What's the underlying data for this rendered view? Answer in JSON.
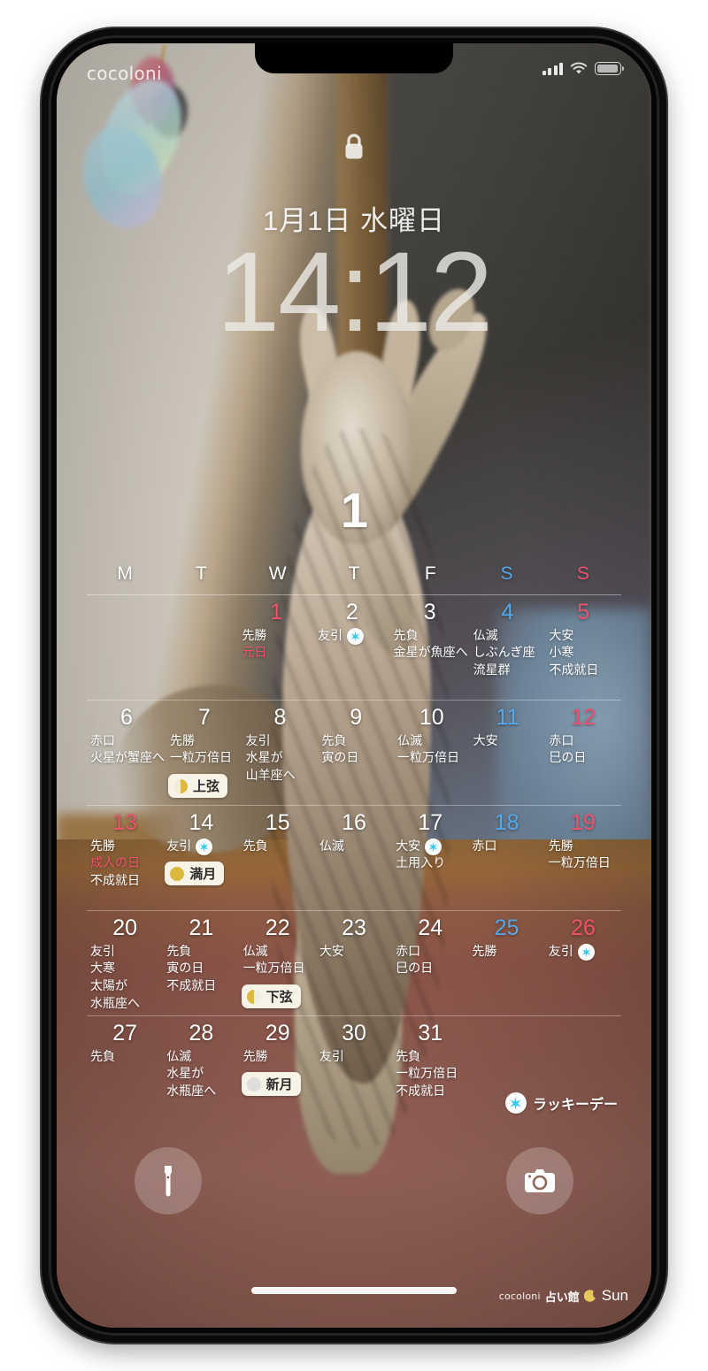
{
  "device": {
    "brand_watermark": "cocoloni"
  },
  "status_bar": {
    "signal_icon": "cellular-bars-icon",
    "wifi_icon": "wifi-icon",
    "battery_icon": "battery-icon"
  },
  "lock_screen": {
    "lock_icon": "lock-icon",
    "date": "1月1日 水曜日",
    "time": "14:12"
  },
  "calendar": {
    "month_label": "1",
    "weekday_headers": [
      {
        "label": "M",
        "kind": "weekday"
      },
      {
        "label": "T",
        "kind": "weekday"
      },
      {
        "label": "W",
        "kind": "weekday"
      },
      {
        "label": "T",
        "kind": "weekday"
      },
      {
        "label": "F",
        "kind": "weekday"
      },
      {
        "label": "S",
        "kind": "saturday"
      },
      {
        "label": "S",
        "kind": "sunday"
      }
    ],
    "weeks": [
      [
        {
          "day": ""
        },
        {
          "day": ""
        },
        {
          "day": "1",
          "kind": "holiday",
          "rokuyo": "先勝",
          "notes": [
            {
              "text": "元日",
              "holiday": true
            }
          ]
        },
        {
          "day": "2",
          "rokuyo": "友引",
          "lucky": true
        },
        {
          "day": "3",
          "rokuyo": "先負",
          "notes": [
            {
              "text": "金星が魚座へ"
            }
          ]
        },
        {
          "day": "4",
          "kind": "saturday",
          "rokuyo": "仏滅",
          "notes": [
            {
              "text": "しぶんぎ座"
            },
            {
              "text": "流星群"
            }
          ]
        },
        {
          "day": "5",
          "kind": "sunday",
          "rokuyo": "大安",
          "notes": [
            {
              "text": "小寒"
            },
            {
              "text": "不成就日"
            }
          ]
        }
      ],
      [
        {
          "day": "6",
          "rokuyo": "赤口",
          "notes": [
            {
              "text": "火星が蟹座へ"
            }
          ]
        },
        {
          "day": "7",
          "rokuyo": "先勝",
          "notes": [
            {
              "text": "一粒万倍日"
            }
          ],
          "moon": {
            "label": "上弦",
            "phase": "first-quarter"
          }
        },
        {
          "day": "8",
          "rokuyo": "友引",
          "notes": [
            {
              "text": "水星が"
            },
            {
              "text": "山羊座へ"
            }
          ]
        },
        {
          "day": "9",
          "rokuyo": "先負",
          "notes": [
            {
              "text": "寅の日"
            }
          ]
        },
        {
          "day": "10",
          "rokuyo": "仏滅",
          "notes": [
            {
              "text": "一粒万倍日"
            }
          ]
        },
        {
          "day": "11",
          "kind": "saturday",
          "rokuyo": "大安"
        },
        {
          "day": "12",
          "kind": "sunday",
          "rokuyo": "赤口",
          "notes": [
            {
              "text": "巳の日"
            }
          ]
        }
      ],
      [
        {
          "day": "13",
          "kind": "holiday",
          "rokuyo": "先勝",
          "notes": [
            {
              "text": "成人の日",
              "holiday": true
            },
            {
              "text": "不成就日"
            }
          ]
        },
        {
          "day": "14",
          "rokuyo": "友引",
          "lucky": true,
          "moon": {
            "label": "満月",
            "phase": "full"
          }
        },
        {
          "day": "15",
          "rokuyo": "先負"
        },
        {
          "day": "16",
          "rokuyo": "仏滅"
        },
        {
          "day": "17",
          "rokuyo": "大安",
          "lucky": true,
          "notes": [
            {
              "text": "土用入り"
            }
          ]
        },
        {
          "day": "18",
          "kind": "saturday",
          "rokuyo": "赤口"
        },
        {
          "day": "19",
          "kind": "sunday",
          "rokuyo": "先勝",
          "notes": [
            {
              "text": "一粒万倍日"
            }
          ]
        }
      ],
      [
        {
          "day": "20",
          "rokuyo": "友引",
          "notes": [
            {
              "text": "大寒"
            },
            {
              "text": "太陽が"
            },
            {
              "text": "水瓶座へ"
            }
          ]
        },
        {
          "day": "21",
          "rokuyo": "先負",
          "notes": [
            {
              "text": "寅の日"
            },
            {
              "text": "不成就日"
            }
          ]
        },
        {
          "day": "22",
          "rokuyo": "仏滅",
          "notes": [
            {
              "text": "一粒万倍日"
            }
          ],
          "moon": {
            "label": "下弦",
            "phase": "last-quarter"
          }
        },
        {
          "day": "23",
          "rokuyo": "大安"
        },
        {
          "day": "24",
          "rokuyo": "赤口",
          "notes": [
            {
              "text": "巳の日"
            }
          ]
        },
        {
          "day": "25",
          "kind": "saturday",
          "rokuyo": "先勝"
        },
        {
          "day": "26",
          "kind": "sunday",
          "rokuyo": "友引",
          "lucky": true
        }
      ],
      [
        {
          "day": "27",
          "rokuyo": "先負"
        },
        {
          "day": "28",
          "rokuyo": "仏滅",
          "notes": [
            {
              "text": "水星が"
            },
            {
              "text": "水瓶座へ"
            }
          ]
        },
        {
          "day": "29",
          "rokuyo": "先勝",
          "moon": {
            "label": "新月",
            "phase": "new"
          }
        },
        {
          "day": "30",
          "rokuyo": "友引"
        },
        {
          "day": "31",
          "rokuyo": "先負",
          "notes": [
            {
              "text": "一粒万倍日"
            },
            {
              "text": "不成就日"
            }
          ]
        },
        {
          "day": ""
        },
        {
          "day": ""
        }
      ]
    ],
    "legend": {
      "label": "ラッキーデー",
      "icon": "lucky-star-icon"
    }
  },
  "bottom_controls": {
    "flashlight_icon": "flashlight-icon",
    "camera_icon": "camera-icon",
    "home_indicator": "home-indicator"
  },
  "footer_brand": {
    "company": "cocoloni",
    "shop": "占い館",
    "moon_icon": "crescent-moon-icon",
    "name": "Sun"
  },
  "colors": {
    "saturday": "#55a8e8",
    "sunday": "#f0526e",
    "holiday": "#f0526e",
    "lucky_star": "#39c8e8",
    "moon_gold": "#dcb93f"
  }
}
